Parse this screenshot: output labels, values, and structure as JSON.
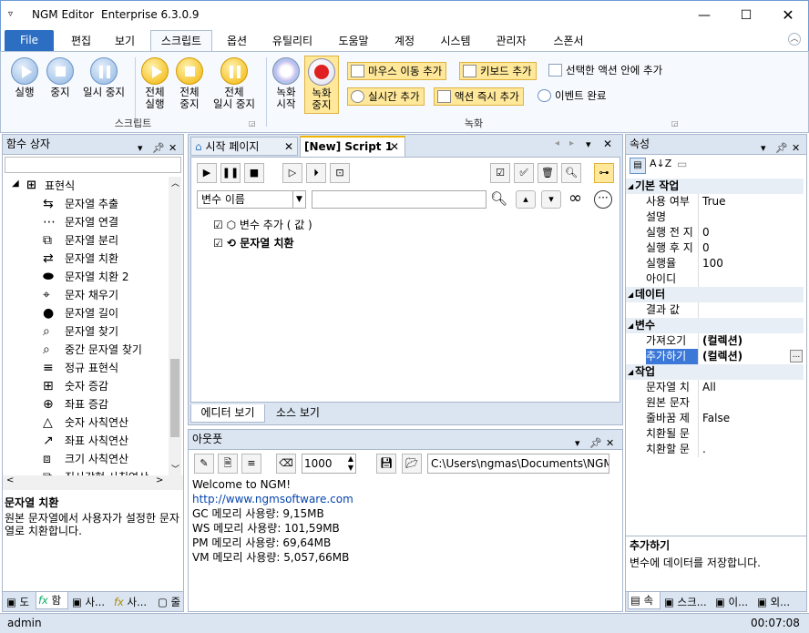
{
  "window": {
    "app": "NGM Editor",
    "edition": "Enterprise 6.3.0.9"
  },
  "menu": {
    "file": "File",
    "tabs": [
      "편집",
      "보기",
      "스크립트",
      "옵션",
      "유틸리티",
      "도움말",
      "계정",
      "시스템",
      "관리자",
      "스폰서"
    ]
  },
  "ribbon": {
    "run": "실행",
    "stop": "중지",
    "pause": "일시 중지",
    "all_run": [
      "전체",
      "실행"
    ],
    "all_stop": [
      "전체",
      "중지"
    ],
    "all_pause": [
      "전체",
      "일시 중지"
    ],
    "script_group": "스크립트",
    "rec_start": [
      "녹화",
      "시작"
    ],
    "rec_stop": [
      "녹화",
      "중지"
    ],
    "mouse_add": "마우스 이동 추가",
    "key_add": "키보드 추가",
    "add_in_action": "선택한 액션 안에 추가",
    "realtime_add": "실시간 추가",
    "action_add": "액션 즉시 추가",
    "event_done": "이벤트 완료",
    "record_group": "녹화"
  },
  "left_panel": {
    "title": "함수 상자",
    "group": "표현식",
    "items": [
      "문자열 추출",
      "문자열 연결",
      "문자열 분리",
      "문자열 치환",
      "문자열 치환 2",
      "문자 채우기",
      "문자열 길이",
      "문자열 찾기",
      "중간 문자열 찾기",
      "정규 표현식",
      "숫자 증감",
      "좌표 증감",
      "숫자 사칙연산",
      "좌표 사칙연산",
      "크기 사칙연산",
      "직사각형 사칙연산"
    ],
    "desc_title": "문자열 치환",
    "desc_text": "원본 문자열에서 사용자가 설정한 문자열로 치환합니다.",
    "tabs": [
      "도",
      "함",
      "사...",
      "사...",
      "줄"
    ]
  },
  "center": {
    "tab_start": "시작 페이지",
    "tab_script": "[New] Script 1",
    "var_dropdown": "변수 이름",
    "script_items": [
      {
        "label": "변수 추가 ( 값 )",
        "bold": false
      },
      {
        "label": "문자열 치환",
        "bold": true
      }
    ],
    "view_tabs": [
      "에디터 보기",
      "소스 보기"
    ]
  },
  "output": {
    "title": "아웃풋",
    "count": "1000",
    "path": "C:\\Users\\ngmas\\Documents\\NGM6\\",
    "lines": [
      "Welcome to NGM!",
      "http://www.ngmsoftware.com",
      "GC 메모리 사용량: 9,15MB",
      "WS 메모리 사용량: 101,59MB",
      "PM 메모리 사용량: 69,64MB",
      "VM 메모리 사용량: 5,057,66MB"
    ]
  },
  "properties": {
    "title": "속성",
    "rows": [
      {
        "cat": true,
        "k": "기본 작업"
      },
      {
        "k": "사용 여부",
        "v": "True"
      },
      {
        "k": "설명",
        "v": ""
      },
      {
        "k": "실행 전 지",
        "v": "0"
      },
      {
        "k": "실행 후 지",
        "v": "0"
      },
      {
        "k": "실행율",
        "v": "100"
      },
      {
        "k": "아이디",
        "v": ""
      },
      {
        "cat": true,
        "k": "데이터"
      },
      {
        "k": "결과 값",
        "v": ""
      },
      {
        "cat": true,
        "k": "변수"
      },
      {
        "k": "가져오기",
        "v": "(컬렉션)"
      },
      {
        "k": "추가하기",
        "v": "(컬렉션)",
        "selected": true
      },
      {
        "cat": true,
        "k": "작업"
      },
      {
        "k": "문자열 치",
        "v": "All"
      },
      {
        "k": "원본 문자",
        "v": ""
      },
      {
        "k": "줄바꿈 제",
        "v": "False"
      },
      {
        "k": "치환될 문",
        "v": ""
      },
      {
        "k": "치환할 문",
        "v": "."
      }
    ],
    "desc_title": "추가하기",
    "desc_text": "변수에 데이터를 저장합니다.",
    "tabs": [
      "속",
      "스크...",
      "이...",
      "외..."
    ]
  },
  "status": {
    "user": "admin",
    "time": "00:07:08"
  }
}
